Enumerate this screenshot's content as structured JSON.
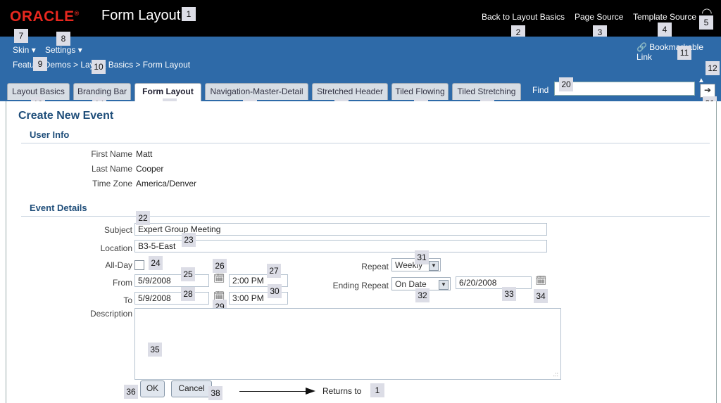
{
  "header": {
    "logo": "ORACLE",
    "title": "Form Layout",
    "links": [
      "Back to Layout Basics",
      "Page Source",
      "Template Source"
    ]
  },
  "menus": {
    "skin": "Skin",
    "settings": "Settings",
    "caret": "▾"
  },
  "breadcrumb": "Feature Demos > Layout Basics > Form Layout",
  "bookmark_label": "Bookmarkable Link",
  "tabs": [
    "Layout Basics",
    "Branding Bar",
    "Form Layout",
    "Navigation-Master-Detail",
    "Stretched Header",
    "Tiled Flowing",
    "Tiled Stretching"
  ],
  "active_tab": "Form Layout",
  "find": {
    "label": "Find",
    "value": "",
    "button": "➔"
  },
  "form": {
    "title": "Create New Event",
    "user_info": {
      "heading": "User Info",
      "first_name_label": "First Name",
      "first_name": "Matt",
      "last_name_label": "Last Name",
      "last_name": "Cooper",
      "time_zone_label": "Time Zone",
      "time_zone": "America/Denver"
    },
    "event_details": {
      "heading": "Event Details",
      "subject_label": "Subject",
      "subject": "Expert Group Meeting",
      "location_label": "Location",
      "location": "B3-5-East",
      "all_day_label": "All-Day",
      "from_label": "From",
      "from_date": "5/9/2008",
      "from_time": "2:00 PM",
      "to_label": "To",
      "to_date": "5/9/2008",
      "to_time": "3:00 PM",
      "repeat_label": "Repeat",
      "repeat_value": "Weekly",
      "ending_repeat_label": "Ending Repeat",
      "ending_repeat_value": "On Date",
      "ending_date": "6/20/2008",
      "description_label": "Description",
      "description": ""
    },
    "ok": "OK",
    "cancel": "Cancel",
    "returns_to": "Returns to"
  },
  "badges": [
    "1",
    "2",
    "3",
    "4",
    "5",
    "7",
    "8",
    "9",
    "10",
    "11",
    "12",
    "13",
    "14",
    "15",
    "16",
    "17",
    "18",
    "19",
    "20",
    "21",
    "22",
    "23",
    "24",
    "25",
    "26",
    "27",
    "28",
    "29",
    "30",
    "31",
    "32",
    "33",
    "34",
    "35",
    "36",
    "38",
    "1"
  ]
}
